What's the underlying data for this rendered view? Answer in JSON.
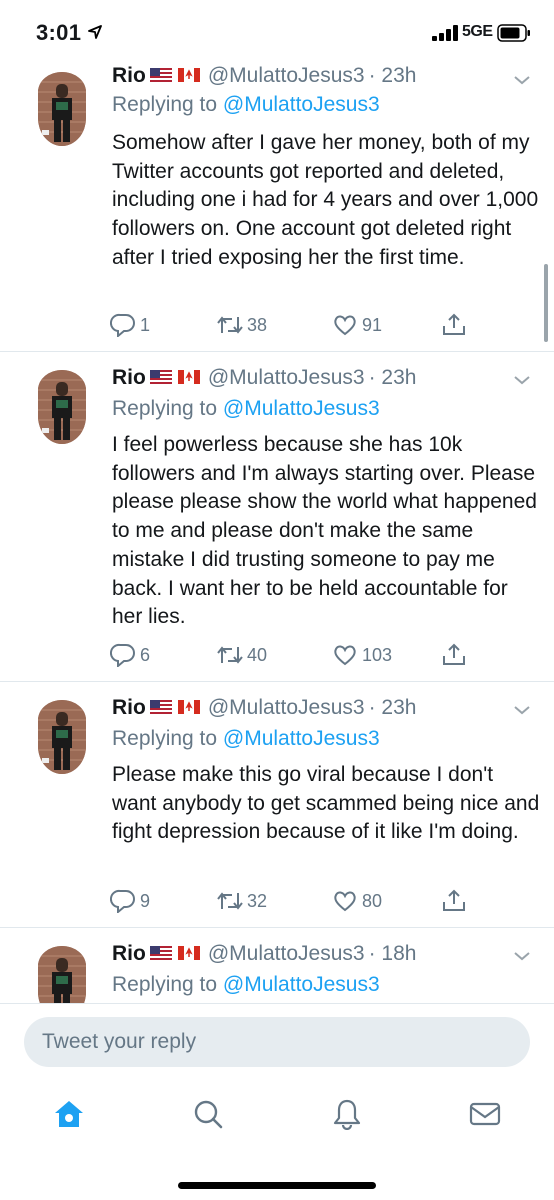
{
  "status_bar": {
    "time": "3:01",
    "network": "5GE"
  },
  "tweets": [
    {
      "name": "Rio",
      "handle": "@MulattoJesus3",
      "time": "· 23h",
      "replying_prefix": "Replying to",
      "replying_to": "@MulattoJesus3",
      "text": "Somehow after I gave her money, both of my Twitter accounts got reported and deleted, including one i had for 4 years and over 1,000 followers on. One account got deleted right after I tried exposing her the first time.",
      "replies": "1",
      "retweets": "38",
      "likes": "91"
    },
    {
      "name": "Rio",
      "handle": "@MulattoJesus3",
      "time": "· 23h",
      "replying_prefix": "Replying to",
      "replying_to": "@MulattoJesus3",
      "text": "I feel powerless because she has 10k followers and I'm always starting over. Please please please show the world what happened to me and please don't make the same mistake I did trusting someone to pay me back.  I want her to be held accountable for her lies.",
      "replies": "6",
      "retweets": "40",
      "likes": "103"
    },
    {
      "name": "Rio",
      "handle": "@MulattoJesus3",
      "time": "· 23h",
      "replying_prefix": "Replying to",
      "replying_to": "@MulattoJesus3",
      "text": "Please make this go viral because I don't want anybody to get scammed being nice and fight depression because of it like I'm doing.",
      "replies": "9",
      "retweets": "32",
      "likes": "80"
    },
    {
      "name": "Rio",
      "handle": "@MulattoJesus3",
      "time": "· 18h",
      "replying_prefix": "Replying to",
      "replying_to": "@MulattoJesus3"
    }
  ],
  "reply_bar": {
    "placeholder": "Tweet your reply"
  },
  "tabs": [
    {
      "icon": "home-icon",
      "active": true
    },
    {
      "icon": "search-icon",
      "active": false
    },
    {
      "icon": "notifications-bell-icon",
      "active": false
    },
    {
      "icon": "messages-envelope-icon",
      "active": false
    }
  ],
  "colors": {
    "accent": "#1da1f2",
    "secondary_text": "#657786",
    "divider": "#e1e8ed"
  }
}
